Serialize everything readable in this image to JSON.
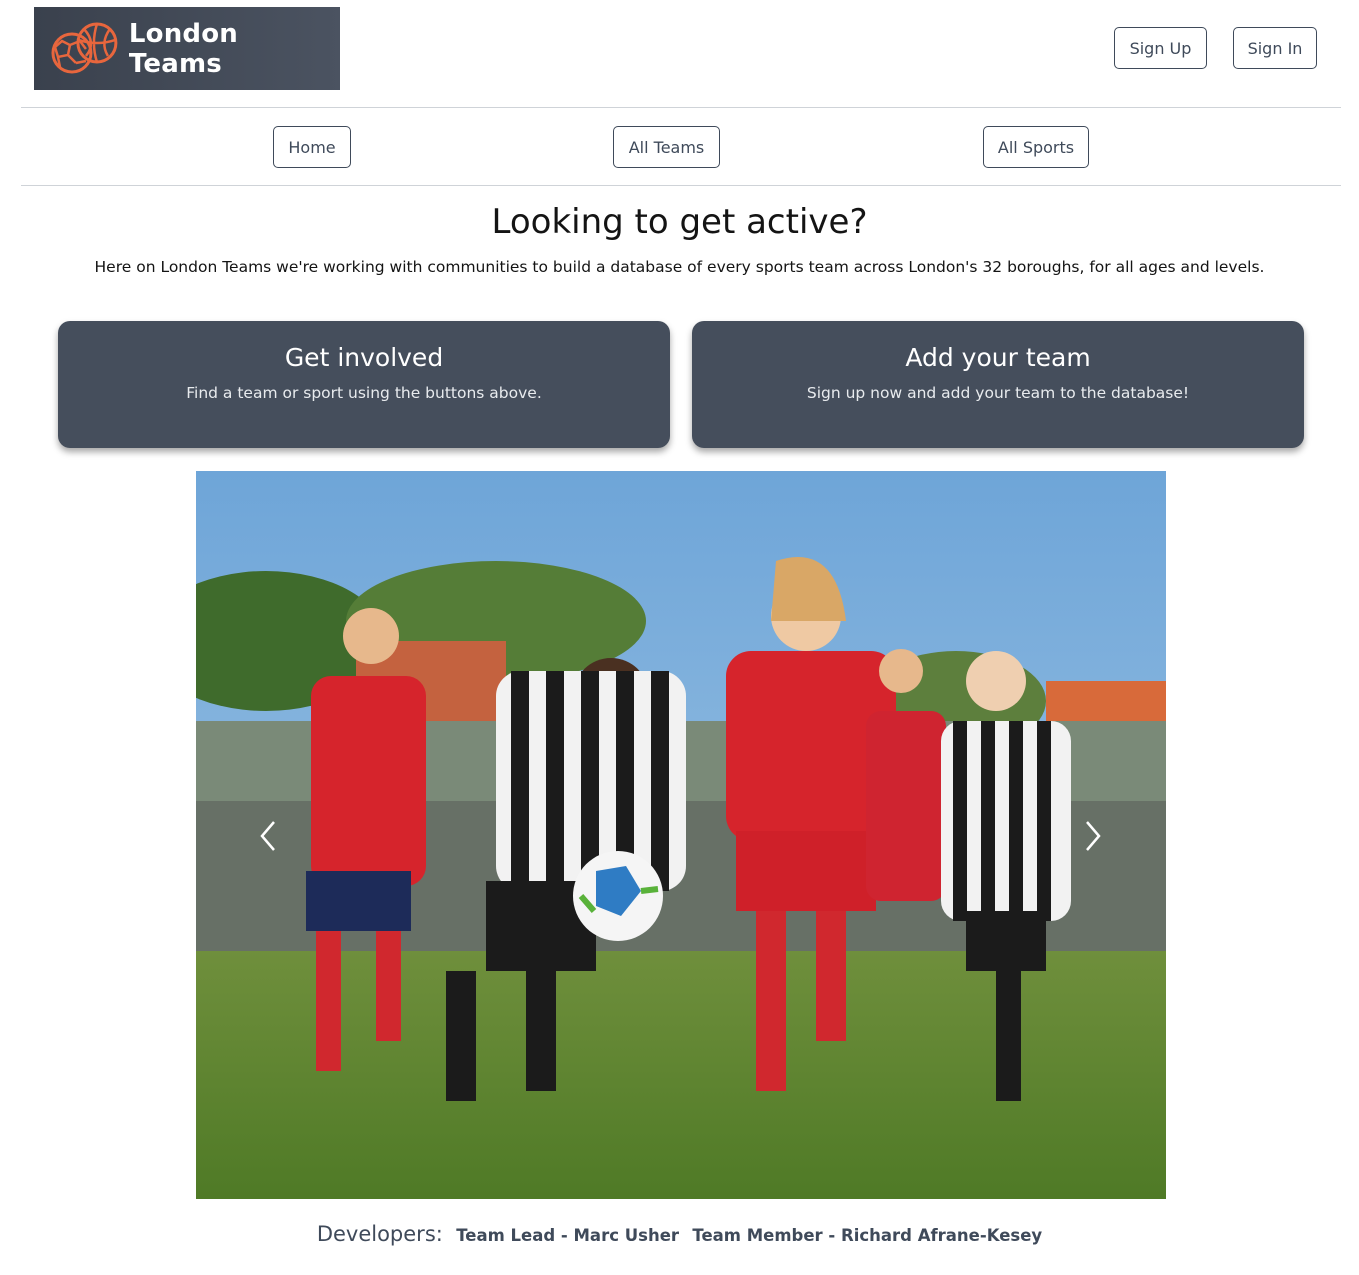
{
  "header": {
    "logo_text": "London Teams",
    "signup_label": "Sign Up",
    "signin_label": "Sign In"
  },
  "nav": {
    "home_label": "Home",
    "teams_label": "All Teams",
    "sports_label": "All Sports"
  },
  "hero": {
    "title": "Looking to get active?",
    "subtitle": "Here on London Teams we're working with communities to build a database of every sports team across London's 32 boroughs, for all ages and levels."
  },
  "cards": [
    {
      "title": "Get involved",
      "text": "Find a team or sport using the buttons above."
    },
    {
      "title": "Add your team",
      "text": "Sign up now and add your team to the database!"
    }
  ],
  "carousel": {
    "image": "youth football match photo",
    "prev_icon": "chevron-left-icon",
    "next_icon": "chevron-right-icon"
  },
  "footer": {
    "label": "Developers:",
    "dev1": "Team Lead - Marc Usher",
    "dev2": "Team Member - Richard Afrane-Kesey"
  },
  "colors": {
    "brand_dark": "#454e5c",
    "accent_orange": "#e8663d",
    "text_dark": "#3f4a5a"
  }
}
